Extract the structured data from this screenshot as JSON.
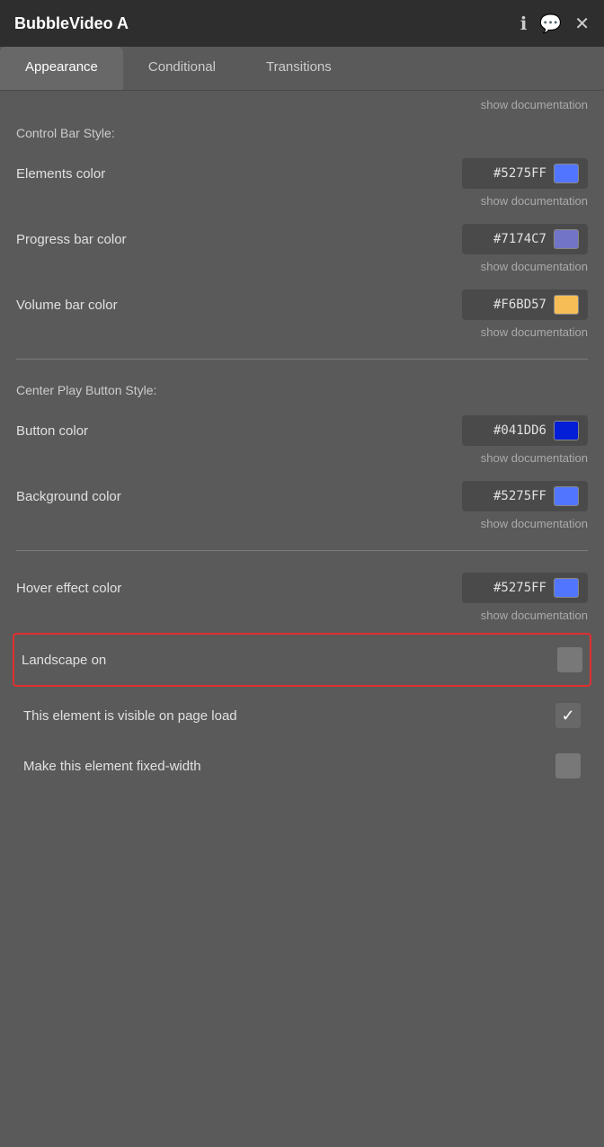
{
  "header": {
    "title": "BubbleVideo A",
    "icons": {
      "info": "ℹ",
      "comment": "💬",
      "close": "✕"
    }
  },
  "tabs": [
    {
      "id": "appearance",
      "label": "Appearance",
      "active": true
    },
    {
      "id": "conditional",
      "label": "Conditional",
      "active": false
    },
    {
      "id": "transitions",
      "label": "Transitions",
      "active": false
    }
  ],
  "show_doc_top": "show documentation",
  "control_bar": {
    "section_label": "Control Bar Style:",
    "rows": [
      {
        "label": "Elements color",
        "hex": "#5275FF",
        "color": "#5275FF",
        "show_doc": "show documentation"
      },
      {
        "label": "Progress bar color",
        "hex": "#7174C7",
        "color": "#7174C7",
        "show_doc": "show documentation"
      },
      {
        "label": "Volume bar color",
        "hex": "#F6BD57",
        "color": "#F6BD57",
        "show_doc": "show documentation"
      }
    ]
  },
  "center_play": {
    "section_label": "Center Play Button Style:",
    "rows": [
      {
        "label": "Button color",
        "hex": "#041DD6",
        "color": "#041DD6",
        "show_doc": "show documentation"
      },
      {
        "label": "Background color",
        "hex": "#5275FF",
        "color": "#5275FF",
        "show_doc": "show documentation"
      }
    ]
  },
  "hover_effect": {
    "label": "Hover effect color",
    "hex": "#5275FF",
    "color": "#5275FF",
    "show_doc": "show documentation"
  },
  "checkboxes": [
    {
      "id": "landscape-on",
      "label": "Landscape on",
      "checked": false,
      "highlighted": true
    },
    {
      "id": "visible-on-load",
      "label": "This element is visible on page load",
      "checked": true,
      "highlighted": false
    },
    {
      "id": "fixed-width",
      "label": "Make this element fixed-width",
      "checked": false,
      "highlighted": false
    }
  ]
}
